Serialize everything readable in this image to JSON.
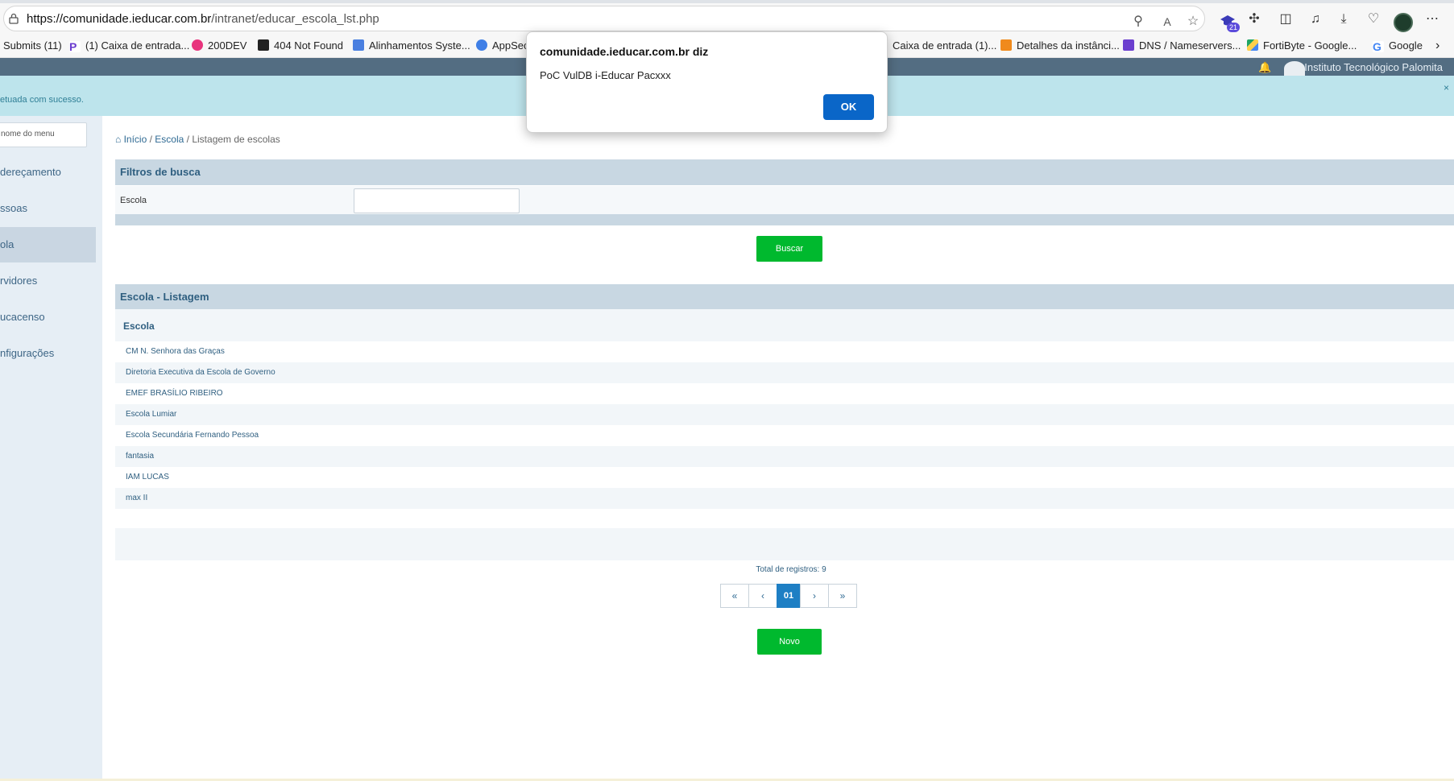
{
  "browser": {
    "url_host": "https://comunidade.ieducar.com.br",
    "url_path": "/intranet/educar_escola_lst.php",
    "extension_badge": "21",
    "bookmarks": [
      {
        "label": "Submits (11)",
        "icon": "none"
      },
      {
        "label": "(1) Caixa de entrada...",
        "icon": "purple-p-icon"
      },
      {
        "label": "200DEV",
        "icon": "pink-swoosh-icon"
      },
      {
        "label": "404 Not Found",
        "icon": "v-logo-icon"
      },
      {
        "label": "Alinhamentos Syste...",
        "icon": "doc-icon"
      },
      {
        "label": "AppSec",
        "icon": "drop-icon"
      },
      {
        "label": "Caixa de entrada (1)...",
        "icon": "none"
      },
      {
        "label": "Detalhes da instânci...",
        "icon": "orange-icon"
      },
      {
        "label": "DNS / Nameservers...",
        "icon": "purple-h-icon"
      },
      {
        "label": "FortiByte - Google...",
        "icon": "drive-icon"
      },
      {
        "label": "Google",
        "icon": "google-icon"
      }
    ]
  },
  "header": {
    "institution": "Instituto Tecnológico Palomita"
  },
  "alert": {
    "text": "etuada com sucesso.",
    "close": "×"
  },
  "sidebar": {
    "search_placeholder": "nome do menu",
    "items": [
      {
        "label": "dereçamento"
      },
      {
        "label": "ssoas"
      },
      {
        "label": "ola"
      },
      {
        "label": "rvidores"
      },
      {
        "label": "ucacenso"
      },
      {
        "label": "nfigurações"
      }
    ]
  },
  "breadcrumb": {
    "home": "Início",
    "sep1": " / ",
    "section": "Escola",
    "sep2": " / ",
    "current": "Listagem de escolas"
  },
  "filters": {
    "title": "Filtros de busca",
    "escola_label": "Escola",
    "escola_value": "",
    "search_button": "Buscar"
  },
  "listing": {
    "title": "Escola - Listagem",
    "column": "Escola",
    "rows": [
      "CM N. Senhora das Graças",
      "Diretoria Executiva da Escola de Governo",
      "EMEF BRASÍLIO RIBEIRO",
      "Escola Lumiar",
      "Escola Secundária Fernando Pessoa",
      "fantasia",
      "IAM LUCAS",
      "max II"
    ],
    "total": "Total de registros: 9",
    "pager": [
      "«",
      "‹",
      "01",
      "›",
      "»"
    ],
    "new_button": "Novo"
  },
  "dialog": {
    "title": "comunidade.ieducar.com.br diz",
    "message": "PoC VulDB i-Educar Pacxxx",
    "ok": "OK"
  }
}
